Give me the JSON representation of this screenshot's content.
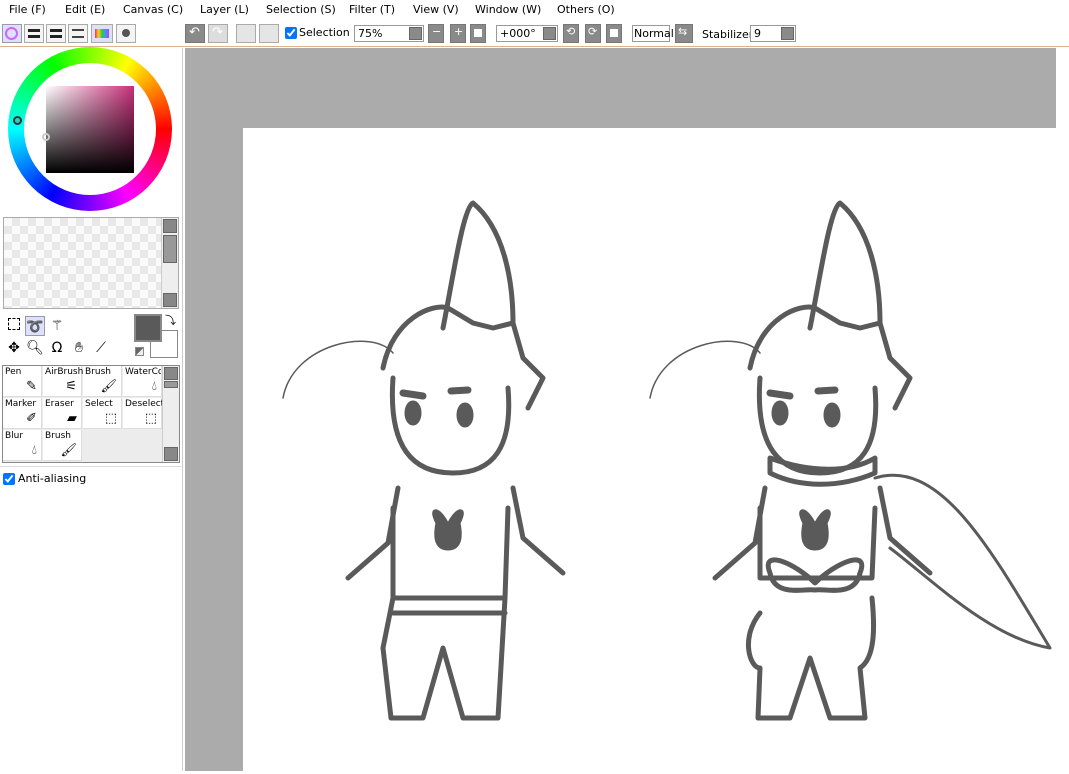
{
  "menu": [
    "File (F)",
    "Edit (E)",
    "Canvas (C)",
    "Layer (L)",
    "Selection (S)",
    "Filter (T)",
    "View (V)",
    "Window (W)",
    "Others (O)"
  ],
  "toolbar": {
    "selection_label": "Selection",
    "selection_checked": true,
    "zoom": "75%",
    "rotation": "+000°",
    "blend_mode": "Normal",
    "stabilizer_label": "Stabilizer",
    "stabilizer_value": "9"
  },
  "colors": {
    "primary": "#5a5a5a",
    "secondary": "#ffffff",
    "hue": "#c8307a"
  },
  "tools": [
    "Pen",
    "AirBrush",
    "Brush",
    "WaterCo",
    "Marker",
    "Eraser",
    "Select",
    "Deselect",
    "Blur",
    "Brush"
  ],
  "anti_aliasing": {
    "label": "Anti-aliasing",
    "checked": true
  }
}
